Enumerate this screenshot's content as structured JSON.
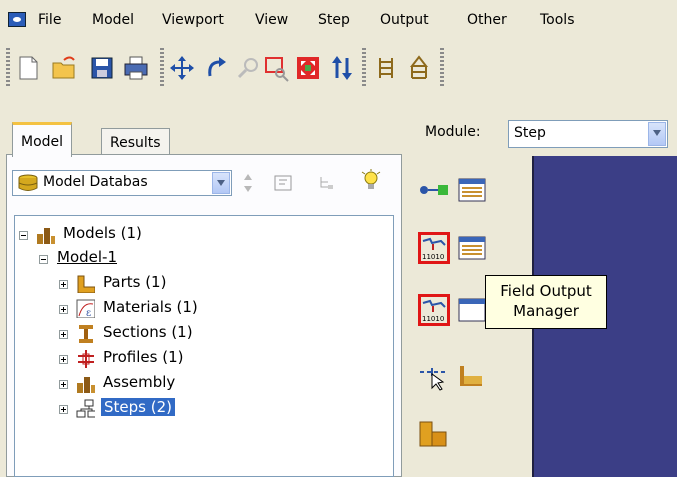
{
  "menubar": {
    "items": [
      {
        "label": "File"
      },
      {
        "label": "Model"
      },
      {
        "label": "Viewport"
      },
      {
        "label": "View"
      },
      {
        "label": "Step"
      },
      {
        "label": "Output"
      },
      {
        "label": "Other"
      },
      {
        "label": "Tools"
      }
    ]
  },
  "toolbar": {
    "icons": [
      "new-file-icon",
      "open-folder-icon",
      "save-icon",
      "print-icon",
      "move-arrows-icon",
      "rotate-icon",
      "magnify-icon",
      "zoom-box-icon",
      "fit-view-icon",
      "sort-icon",
      "tile-horizontal-icon",
      "tile-vertical-icon"
    ]
  },
  "tabs": {
    "model": "Model",
    "results": "Results"
  },
  "model_tree": {
    "selector": "Model Databas",
    "rows": {
      "models": "Models (1)",
      "model1": "Model-1",
      "parts": "Parts (1)",
      "materials": "Materials (1)",
      "sections": "Sections (1)",
      "profiles": "Profiles (1)",
      "assembly": "Assembly",
      "steps": "Steps (2)"
    }
  },
  "module": {
    "label": "Module:",
    "value": "Step"
  },
  "tooltip": {
    "line1": "Field Output",
    "line2": "Manager"
  },
  "colors": {
    "highlight": "#e01616",
    "viewport": "#3b3e86",
    "selection": "#316ac5"
  }
}
